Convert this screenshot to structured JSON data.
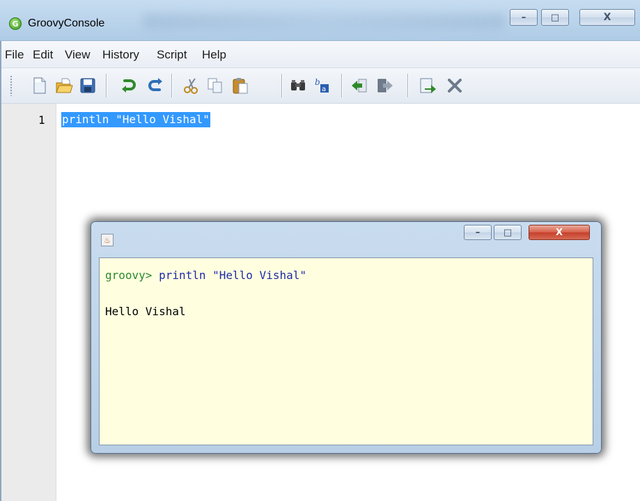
{
  "window": {
    "title": "GroovyConsole",
    "app_icon_letter": "G"
  },
  "caption_buttons": {
    "minimize": "–",
    "maximize": "□",
    "close": "X"
  },
  "menu": {
    "items": [
      "File",
      "Edit",
      "View",
      "History",
      "Script",
      "Help"
    ]
  },
  "toolbar": {
    "icons": [
      "new-file-icon",
      "open-folder-icon",
      "save-icon",
      "undo-icon",
      "redo-icon",
      "cut-icon",
      "copy-icon",
      "paste-icon",
      "find-icon",
      "replace-icon",
      "history-previous-icon",
      "history-next-icon",
      "run-script-icon",
      "interrupt-icon"
    ]
  },
  "editor": {
    "line_number": "1",
    "code": "println \"Hello Vishal\""
  },
  "output_window": {
    "prompt": "groovy> ",
    "command": "println \"Hello Vishal\"",
    "result": "Hello Vishal"
  },
  "colors": {
    "selection": "#3399ff",
    "output_background": "#ffffe0",
    "prompt_green": "#2d8a2d",
    "command_blue": "#1f2aa8"
  }
}
